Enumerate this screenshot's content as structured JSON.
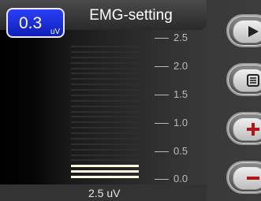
{
  "header": {
    "title": "EMG-setting"
  },
  "level_badge": {
    "value": "0.3",
    "unit": "uV"
  },
  "meter": {
    "range_max_uV": 2.5,
    "level_uV": 0.3,
    "segments": 25
  },
  "scale": {
    "ticks": [
      "2.5",
      "2.0",
      "1.5",
      "1.0",
      "0.5",
      "0.0"
    ]
  },
  "footer": {
    "range_label": "2.5 uV"
  },
  "controls": [
    {
      "icon": "play-icon"
    },
    {
      "icon": "menu-icon"
    },
    {
      "icon": "plus-icon"
    },
    {
      "icon": "minus-icon"
    }
  ],
  "colors": {
    "accent": "#1a2fe0",
    "meter_on": "#fffbe0",
    "meter_off": "#2e2e2e"
  }
}
